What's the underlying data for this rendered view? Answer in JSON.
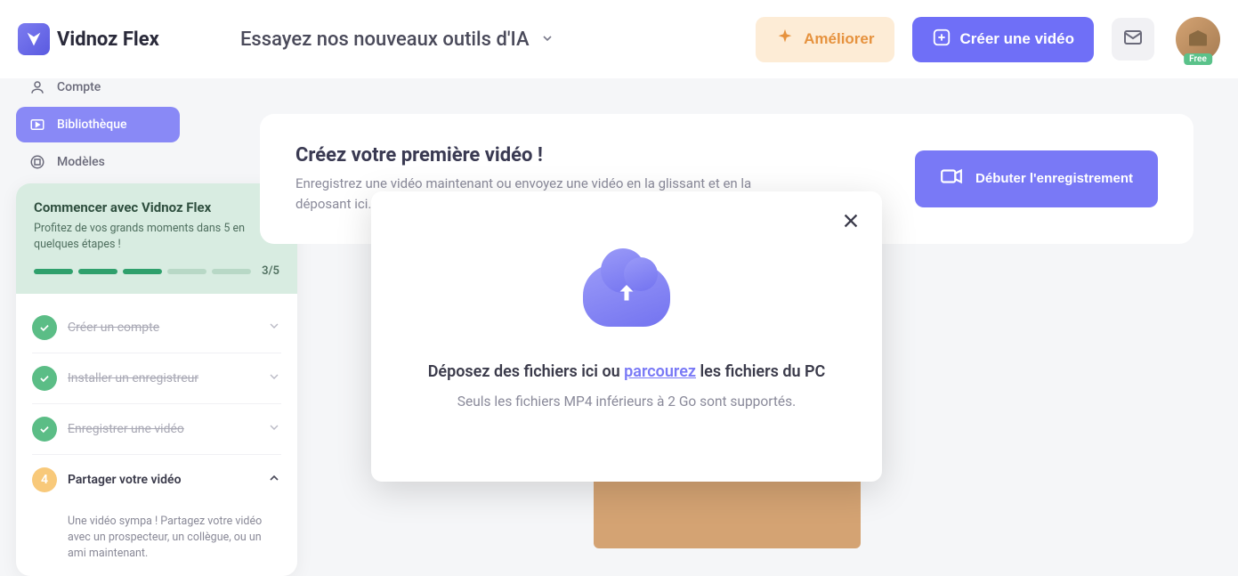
{
  "brand": {
    "name": "Vidnoz Flex"
  },
  "header": {
    "tools_label": "Essayez nos nouveaux outils d'IA",
    "ameliorer": "Améliorer",
    "create_video": "Créer une vidéo",
    "badge_free": "Free"
  },
  "sidebar": {
    "items": [
      {
        "label": "Compte",
        "icon": "user-icon"
      },
      {
        "label": "Bibliothèque",
        "icon": "library-icon"
      },
      {
        "label": "Modèles",
        "icon": "templates-icon"
      }
    ]
  },
  "onboard": {
    "title": "Commencer avec Vidnoz Flex",
    "subtitle": "Profitez de vos grands moments dans 5 en quelques étapes !",
    "progress_text": "3/5",
    "progress_done": 3,
    "progress_total": 5,
    "steps": [
      {
        "label": "Créer un compte",
        "state": "done"
      },
      {
        "label": "Installer un enregistreur",
        "state": "done"
      },
      {
        "label": "Enregistrer une vidéo",
        "state": "done"
      },
      {
        "label": "Partager votre vidéo",
        "state": "current"
      }
    ],
    "current_desc": "Une vidéo sympa ! Partagez votre vidéo avec un prospecteur, un collègue, ou un ami maintenant."
  },
  "hero": {
    "title": "Créez votre première vidéo !",
    "subtitle": "Enregistrez une vidéo maintenant ou envoyez une vidéo en la glissant et en la déposant ici.",
    "record_btn": "Débuter l'enregistrement"
  },
  "modal": {
    "drop_prefix": "Déposez des fichiers ici ou ",
    "browse": "parcourez",
    "drop_suffix": " les fichiers du PC",
    "hint": "Seuls les fichiers MP4 inférieurs à 2 Go sont supportés."
  }
}
